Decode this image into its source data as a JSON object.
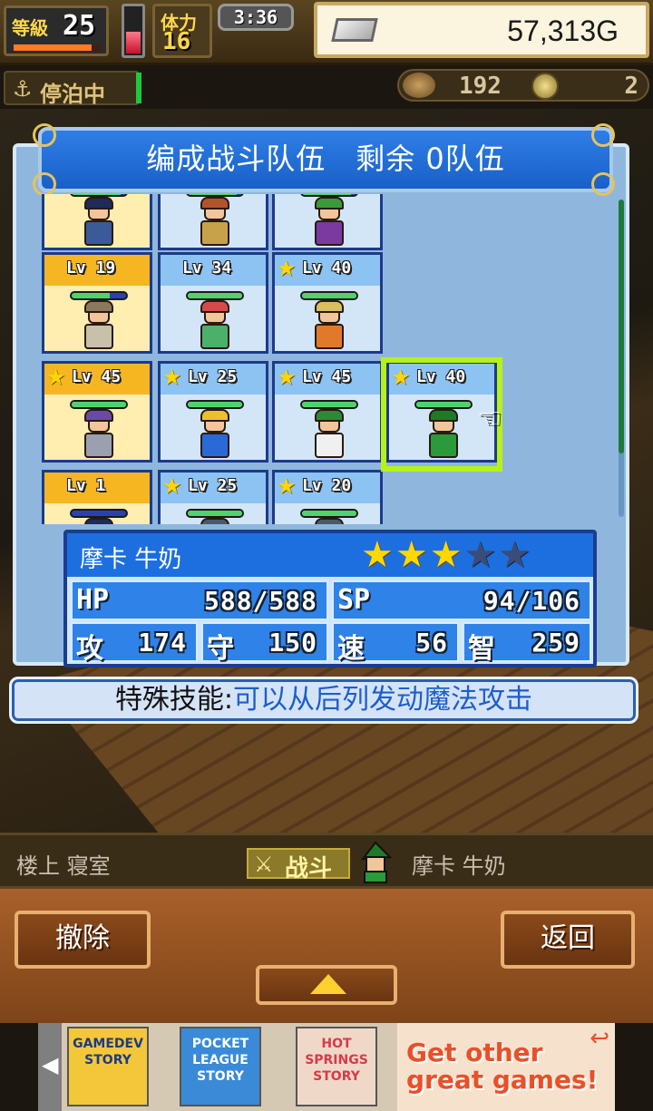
{
  "hud": {
    "level_label": "等級",
    "level_value": "25",
    "level_progress": 0.9,
    "stamina_level": 0.45,
    "stamina_label": "体力",
    "stamina_value": "16",
    "clock": "3:36",
    "gold": "57,313G"
  },
  "status": {
    "anchor_icon": "anchor-icon",
    "label": "停泊中",
    "resource_count": "192",
    "resource_count_2": "2"
  },
  "panel": {
    "title": "编成战斗队伍　剩余 0队伍",
    "rows": [
      [
        {
          "lv": "",
          "star": false,
          "style": "gold",
          "hp": 0.9,
          "char_color": "#3a5a9a",
          "hair_color": "#1e2a5a"
        },
        {
          "lv": "",
          "star": false,
          "style": "blue",
          "hp": 0.9,
          "char_color": "#c8a24a",
          "hair_color": "#b2542a"
        },
        {
          "lv": "",
          "star": false,
          "style": "blue",
          "hp": 0.9,
          "char_color": "#7a3aa0",
          "hair_color": "#3a9a3a"
        }
      ],
      [
        {
          "lv": "Lv 19",
          "star": false,
          "style": "gold",
          "hp": 0.7,
          "char_color": "#c8c0a8",
          "hair_color": "#8a7a5a"
        },
        {
          "lv": "Lv 34",
          "star": false,
          "style": "blue",
          "hp": 1.0,
          "char_color": "#4ab06a",
          "hair_color": "#d84a4a"
        },
        {
          "lv": "Lv 40",
          "star": true,
          "style": "blue",
          "hp": 1.0,
          "char_color": "#e07a2a",
          "hair_color": "#d8c060"
        }
      ],
      [
        {
          "lv": "Lv 45",
          "star": true,
          "style": "gold",
          "hp": 1.0,
          "char_color": "#9aa0b0",
          "hair_color": "#6a4aa8"
        },
        {
          "lv": "Lv 25",
          "star": true,
          "style": "blue",
          "hp": 1.0,
          "char_color": "#2a6ad8",
          "hair_color": "#e8c030"
        },
        {
          "lv": "Lv 45",
          "star": true,
          "style": "blue",
          "hp": 1.0,
          "char_color": "#f0f0f0",
          "hair_color": "#2a8a3a"
        },
        {
          "lv": "Lv 40",
          "star": true,
          "style": "blue",
          "hp": 1.0,
          "char_color": "#2a9a3a",
          "hair_color": "#1e7a2a"
        }
      ],
      [
        {
          "lv": "Lv 1",
          "star": false,
          "style": "gold",
          "hp": 0.0,
          "char_color": "#3a5a9a",
          "hair_color": "#1e2a5a"
        },
        {
          "lv": "Lv 25",
          "star": true,
          "style": "blue",
          "hp": 1.0,
          "char_color": "#7a8a9a",
          "hair_color": "#4a5a6a"
        },
        {
          "lv": "Lv 20",
          "star": true,
          "style": "blue",
          "hp": 1.0,
          "char_color": "#7a8a9a",
          "hair_color": "#4a5a6a"
        }
      ]
    ]
  },
  "character": {
    "name": "摩卡 牛奶",
    "stars_filled": 3,
    "stars_total": 5,
    "stats": {
      "hp_label": "HP",
      "hp_value": "588/588",
      "sp_label": "SP",
      "sp_value": "94/106",
      "atk_label": "攻",
      "atk_value": "174",
      "def_label": "守",
      "def_value": "150",
      "spd_label": "速",
      "spd_value": "56",
      "int_label": "智",
      "int_value": "259"
    },
    "skill_label": "特殊技能:",
    "skill_text": "可以从后列发动魔法攻击"
  },
  "bottom": {
    "room": "楼上 寝室",
    "battle_label": "战斗",
    "char_name": "摩卡 牛奶",
    "cancel_label": "撤除",
    "back_label": "返回"
  },
  "ad": {
    "games": [
      "GAMEDEV STORY",
      "POCKET LEAGUE STORY",
      "HOT SPRINGS STORY"
    ],
    "cta": "Get other great games!"
  },
  "colors": {
    "panel_blue": "#1d6fe0",
    "selector_green": "#b6f218",
    "star_gold": "#ffd800",
    "skill_blue": "#1e5ecc"
  }
}
